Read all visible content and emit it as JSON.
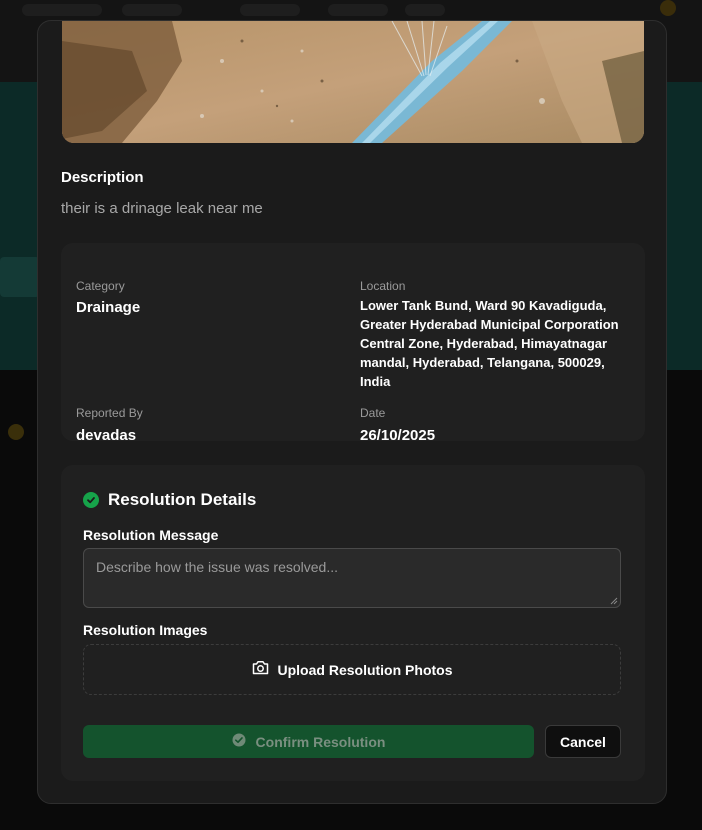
{
  "modal": {
    "description_heading": "Description",
    "description_text": "their is a drinage leak near me",
    "details": {
      "category_label": "Category",
      "category_value": "Drainage",
      "location_label": "Location",
      "location_value": "Lower Tank Bund, Ward 90 Kavadiguda, Greater Hyderabad Municipal Corporation Central Zone, Hyderabad, Himayatnagar mandal, Hyderabad, Telangana, 500029, India",
      "reported_by_label": "Reported By",
      "reported_by_value": "devadas",
      "date_label": "Date",
      "date_value": "26/10/2025"
    },
    "resolution": {
      "title": "Resolution Details",
      "message_label": "Resolution Message",
      "message_value": "",
      "message_placeholder": "Describe how the issue was resolved...",
      "images_label": "Resolution Images",
      "upload_label": "Upload Resolution Photos",
      "confirm_label": "Confirm Resolution",
      "confirm_disabled": true,
      "cancel_label": "Cancel"
    }
  },
  "colors": {
    "modal_bg": "#1b1b1b",
    "card_bg": "#202020",
    "success_green": "#16a34a",
    "confirm_bg": "#14532d",
    "muted_text": "#a8a8a8"
  },
  "icons": {
    "resolution_title": "check-circle-icon",
    "upload": "camera-icon",
    "confirm": "check-circle-icon"
  }
}
